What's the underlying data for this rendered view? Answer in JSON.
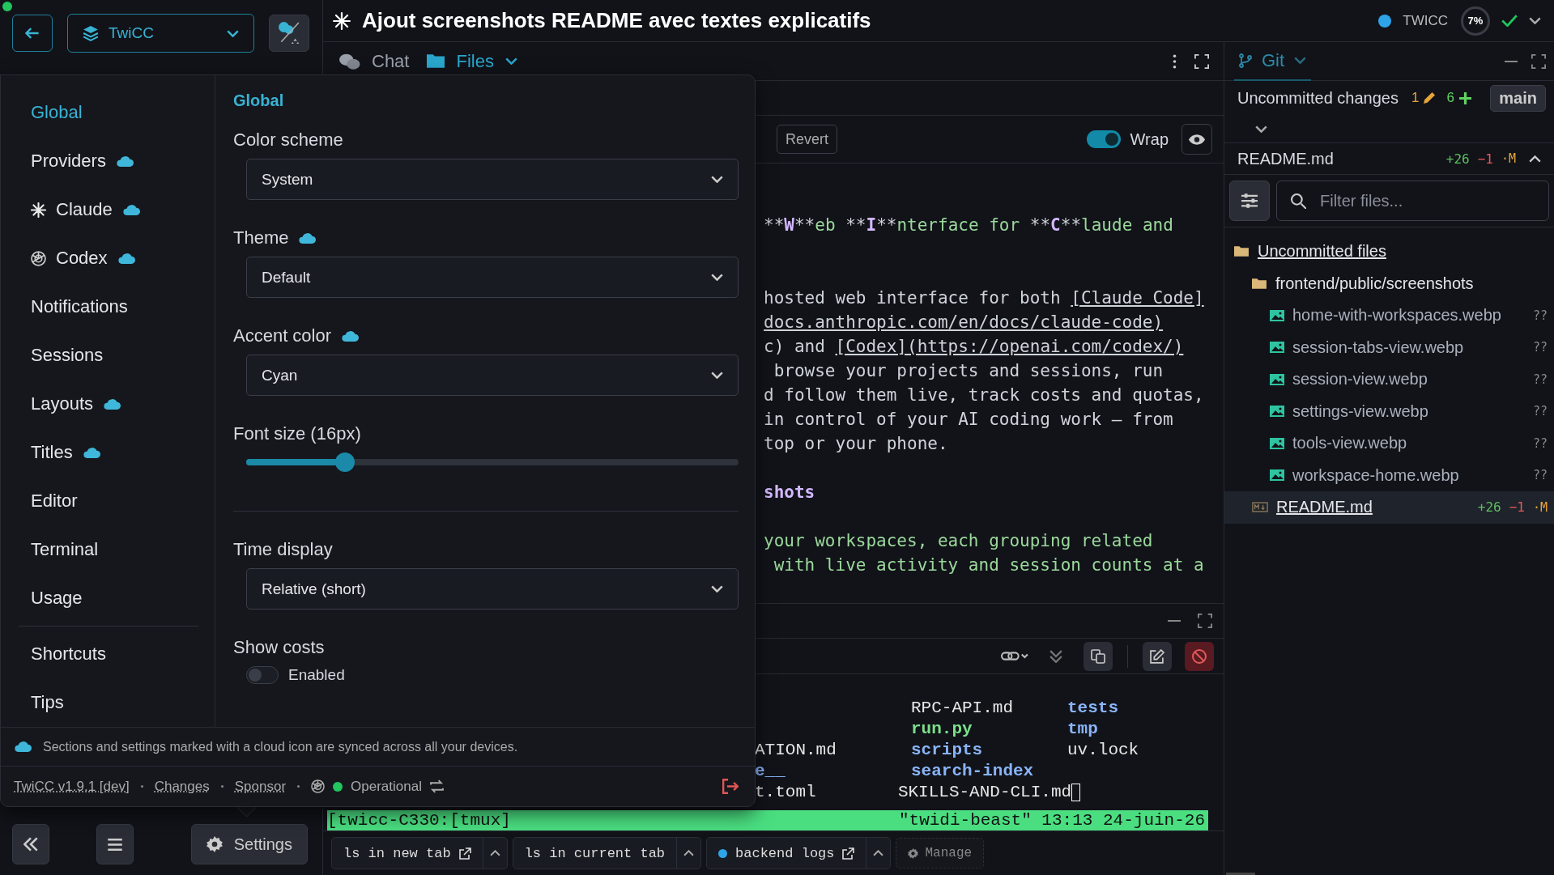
{
  "sidebar": {
    "project": "TwiCC",
    "settings_button": "Settings"
  },
  "session": {
    "title": "Ajout screenshots README avec textes explicatifs",
    "workspace": "TWICC",
    "usage": "7%"
  },
  "tabs": [
    {
      "label": "Chat",
      "selected": false
    },
    {
      "label": "Files",
      "selected": true
    }
  ],
  "editor": {
    "revert": "Revert",
    "wrap": {
      "label": "Wrap",
      "on": true
    },
    "lines": [
      {
        "kind": "code",
        "segments": [
          {
            "kind": "mark",
            "text": "**"
          },
          {
            "kind": "strong",
            "text": "W"
          },
          {
            "kind": "mark",
            "text": "**"
          },
          {
            "kind": "green",
            "text": "eb "
          },
          {
            "kind": "mark",
            "text": "**"
          },
          {
            "kind": "strong",
            "text": "I"
          },
          {
            "kind": "mark",
            "text": "**"
          },
          {
            "kind": "green",
            "text": "nterface for "
          },
          {
            "kind": "mark",
            "text": "**"
          },
          {
            "kind": "strong",
            "text": "C"
          },
          {
            "kind": "mark",
            "text": "**"
          },
          {
            "kind": "green",
            "text": "laude and"
          }
        ]
      },
      {
        "kind": "blank"
      },
      {
        "kind": "blank"
      },
      {
        "kind": "code",
        "segments": [
          {
            "kind": "plain",
            "text": "hosted web interface for both "
          },
          {
            "kind": "link",
            "text": "[Claude Code]"
          }
        ]
      },
      {
        "kind": "code",
        "segments": [
          {
            "kind": "link",
            "text": "docs.anthropic.com/en/docs/claude-code)"
          }
        ]
      },
      {
        "kind": "code",
        "segments": [
          {
            "kind": "plain",
            "text": "c) and "
          },
          {
            "kind": "link",
            "text": "[Codex](https://openai.com/codex/)"
          }
        ]
      },
      {
        "kind": "code",
        "segments": [
          {
            "kind": "plain",
            "text": " browse your projects and sessions, run"
          }
        ]
      },
      {
        "kind": "code",
        "segments": [
          {
            "kind": "plain",
            "text": "d follow them live, track costs and quotas,"
          }
        ]
      },
      {
        "kind": "code",
        "segments": [
          {
            "kind": "plain",
            "text": "in control of your AI coding work — from"
          }
        ]
      },
      {
        "kind": "code",
        "segments": [
          {
            "kind": "plain",
            "text": "top or your phone."
          }
        ]
      },
      {
        "kind": "blank"
      },
      {
        "kind": "code",
        "segments": [
          {
            "kind": "heading",
            "text": "shots"
          }
        ]
      },
      {
        "kind": "blank"
      },
      {
        "kind": "code",
        "segments": [
          {
            "kind": "green",
            "text": "your workspaces, each grouping related"
          }
        ]
      },
      {
        "kind": "code",
        "segments": [
          {
            "kind": "green",
            "text": " with live activity and session counts at a"
          }
        ]
      }
    ]
  },
  "terminal": {
    "rows": [
      {
        "col_2": {
          "text": "RPC-API.md",
          "kind": "file"
        },
        "col_3": {
          "text": "tests",
          "kind": "dir"
        }
      },
      {
        "col_2": {
          "text": "run.py",
          "kind": "exec"
        },
        "col_3": {
          "text": "tmp",
          "kind": "dir"
        }
      },
      {
        "col_1": {
          "text": "ATION.md",
          "kind": "file"
        },
        "col_2": {
          "text": "scripts",
          "kind": "dir"
        },
        "col_3": {
          "text": "uv.lock",
          "kind": "file"
        }
      },
      {
        "col_1": {
          "text": "e__",
          "kind": "dir"
        },
        "col_2": {
          "text": "search-index",
          "kind": "dir"
        }
      },
      {
        "col_1": {
          "text": "t.toml",
          "kind": "file"
        },
        "col_2": {
          "text": "SKILLS-AND-CLI.md",
          "kind": "file",
          "cursor": true
        }
      }
    ],
    "status_left": "[twicc-C330:[tmux]",
    "status_right": "\"twidi-beast\" 13:13 24-juin-26"
  },
  "quick_actions": [
    {
      "label": "ls in new tab",
      "external": true
    },
    {
      "label": "ls in current tab",
      "external": false
    },
    {
      "label": "backend logs",
      "external": true,
      "color": "#2ea3e8"
    }
  ],
  "manage": "Manage",
  "git": {
    "tab": "Git",
    "changes_label": "Uncommitted changes",
    "modified": "1",
    "added": "6",
    "branch": "main",
    "file": {
      "name": "README.md",
      "additions": "+26",
      "deletions": "−1",
      "status": "·M"
    },
    "filter_placeholder": "Filter files...",
    "tree": [
      {
        "label": "Uncommitted files",
        "kind": "folder",
        "selected": false,
        "children": [
          {
            "label": "frontend/public/screenshots",
            "kind": "folder",
            "selected": false,
            "children": [
              {
                "label": "home-with-workspaces.webp",
                "kind": "image",
                "status": "??",
                "selected": false
              },
              {
                "label": "session-tabs-view.webp",
                "kind": "image",
                "status": "??",
                "selected": false
              },
              {
                "label": "session-view.webp",
                "kind": "image",
                "status": "??",
                "selected": false
              },
              {
                "label": "settings-view.webp",
                "kind": "image",
                "status": "??",
                "selected": false
              },
              {
                "label": "tools-view.webp",
                "kind": "image",
                "status": "??",
                "selected": false
              },
              {
                "label": "workspace-home.webp",
                "kind": "image",
                "status": "??",
                "selected": false
              }
            ]
          },
          {
            "label": "README.md",
            "kind": "markdown",
            "additions": "+26",
            "deletions": "−1",
            "status": "·M",
            "selected": true
          }
        ]
      }
    ]
  },
  "settings": {
    "nav": [
      {
        "label": "Global",
        "synced": false,
        "selected": true
      },
      {
        "label": "Providers",
        "synced": true,
        "selected": false
      },
      {
        "label": "Claude",
        "synced": true,
        "selected": false
      },
      {
        "label": "Codex",
        "synced": true,
        "selected": false
      },
      {
        "label": "Notifications",
        "synced": false,
        "selected": false
      },
      {
        "label": "Sessions",
        "synced": false,
        "selected": false
      },
      {
        "label": "Layouts",
        "synced": true,
        "selected": false
      },
      {
        "label": "Titles",
        "synced": true,
        "selected": false
      },
      {
        "label": "Editor",
        "synced": false,
        "selected": false
      },
      {
        "label": "Terminal",
        "synced": false,
        "selected": false
      },
      {
        "label": "Usage",
        "synced": false,
        "selected": false
      }
    ],
    "nav_extra": [
      {
        "label": "Shortcuts",
        "synced": false,
        "selected": false
      },
      {
        "label": "Tips",
        "synced": false,
        "selected": false
      }
    ],
    "section": "Global",
    "fields": [
      {
        "kind": "select",
        "label": "Color scheme",
        "synced": false,
        "value": "System"
      },
      {
        "kind": "select",
        "label": "Theme",
        "synced": true,
        "value": "Default"
      },
      {
        "kind": "select",
        "label": "Accent color",
        "synced": true,
        "value": "Cyan"
      },
      {
        "kind": "slider",
        "label": "Font size (16px)",
        "synced": false,
        "level": 0.2
      },
      {
        "kind": "select",
        "label": "Time display",
        "synced": false,
        "value": "Relative (short)"
      },
      {
        "kind": "toggle",
        "label": "Show costs",
        "synced": false,
        "toggle_label": "Enabled",
        "on": false
      }
    ],
    "notice": "Sections and settings marked with a cloud icon are synced across all your devices.",
    "version": "TwiCC v1.9.1 [dev]",
    "links": [
      "Changes",
      "Sponsor"
    ],
    "status": {
      "label": "Operational",
      "color": "#22c55e"
    }
  }
}
